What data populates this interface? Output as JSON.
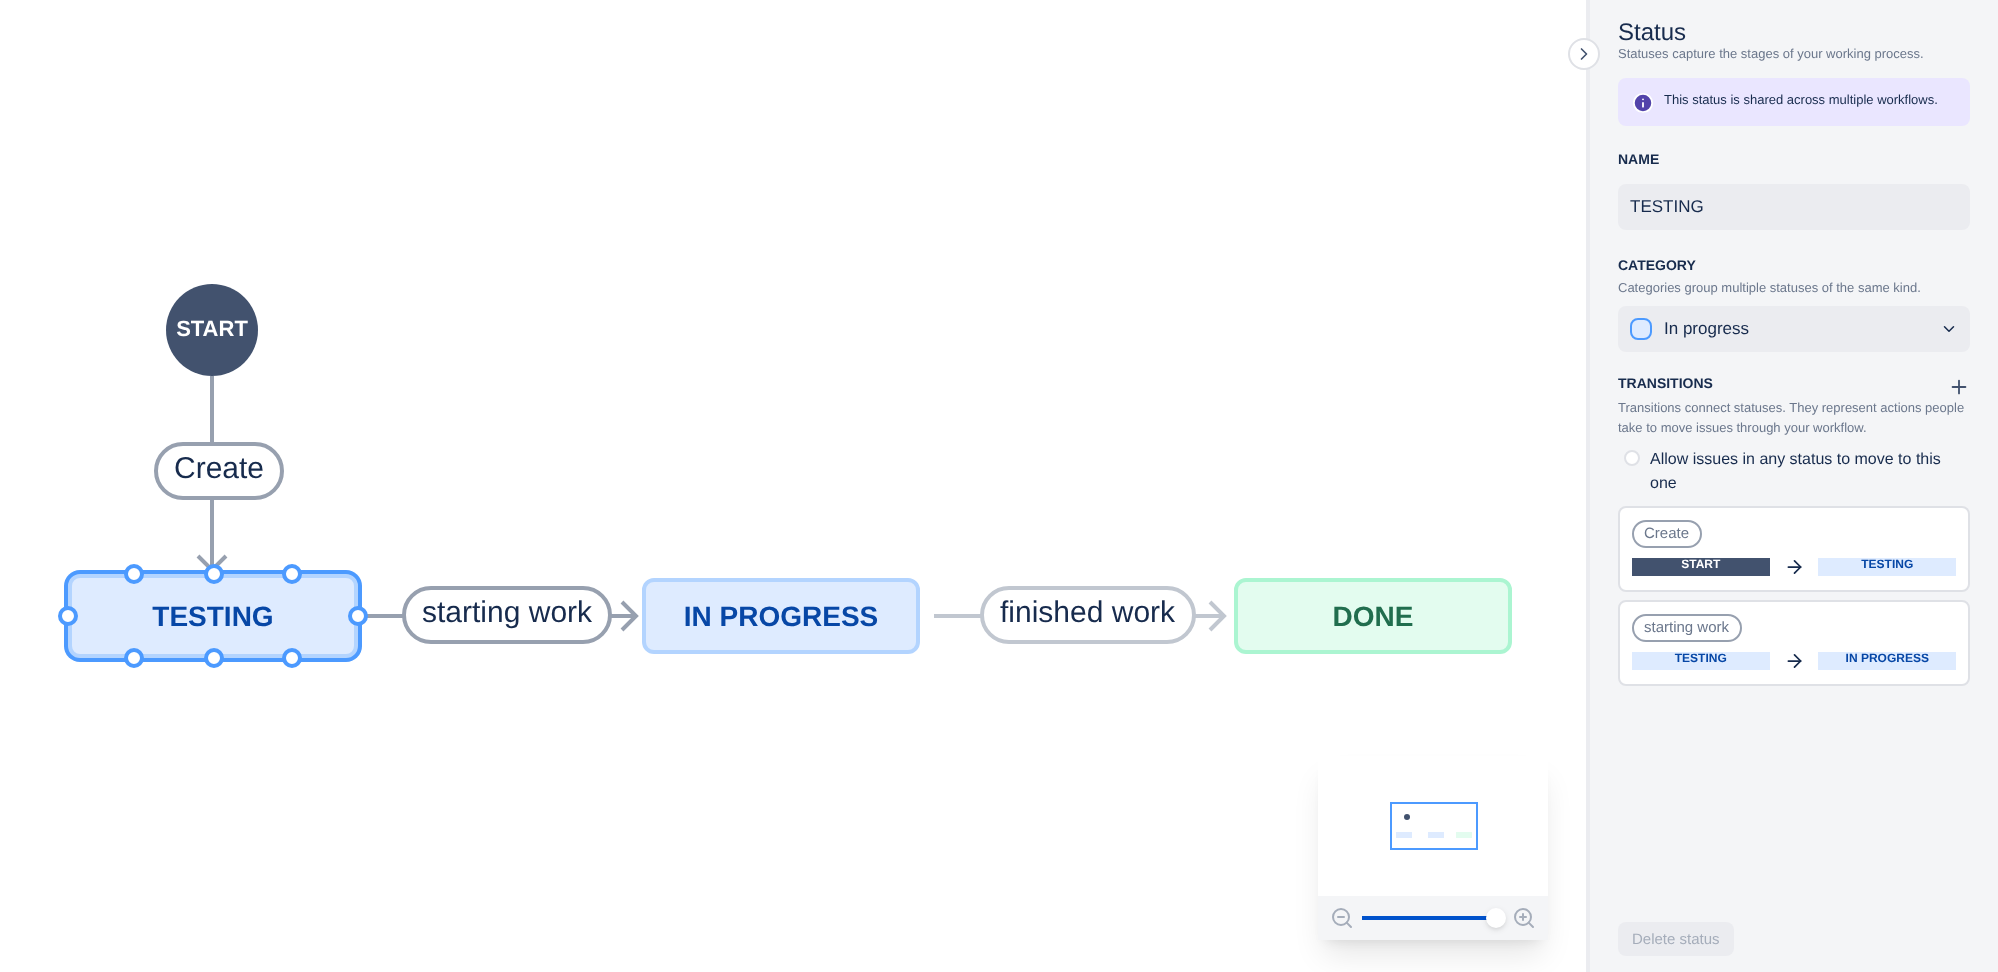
{
  "canvas": {
    "nodes": [
      {
        "label": "START",
        "kind": "start",
        "selected": false
      },
      {
        "label": "TESTING",
        "kind": "in_progress",
        "selected": true
      },
      {
        "label": "IN PROGRESS",
        "kind": "in_progress",
        "selected": false
      },
      {
        "label": "DONE",
        "kind": "done",
        "selected": false
      }
    ],
    "transitions": [
      "Create",
      "starting work",
      "finished work"
    ],
    "zoom": {
      "level": 0.95
    }
  },
  "panel": {
    "title": "Status",
    "subtitle": "Statuses capture the stages of your working process.",
    "notice": "This status is shared across multiple workflows.",
    "name": {
      "label": "NAME",
      "value": "TESTING"
    },
    "category": {
      "label": "CATEGORY",
      "hint": "Categories group multiple statuses of the same kind.",
      "value": "In progress"
    },
    "transitions": {
      "label": "TRANSITIONS",
      "hint": "Transitions connect statuses. They represent actions people take to move issues through your workflow.",
      "allow_any": {
        "label": "Allow issues in any status to move to this one",
        "checked": false
      },
      "items": [
        {
          "name": "Create",
          "from": {
            "label": "START",
            "kind": "start"
          },
          "to": {
            "label": "TESTING",
            "kind": "in_progress"
          }
        },
        {
          "name": "starting work",
          "from": {
            "label": "TESTING",
            "kind": "in_progress"
          },
          "to": {
            "label": "IN PROGRESS",
            "kind": "in_progress"
          }
        }
      ]
    },
    "delete_button": "Delete status"
  }
}
